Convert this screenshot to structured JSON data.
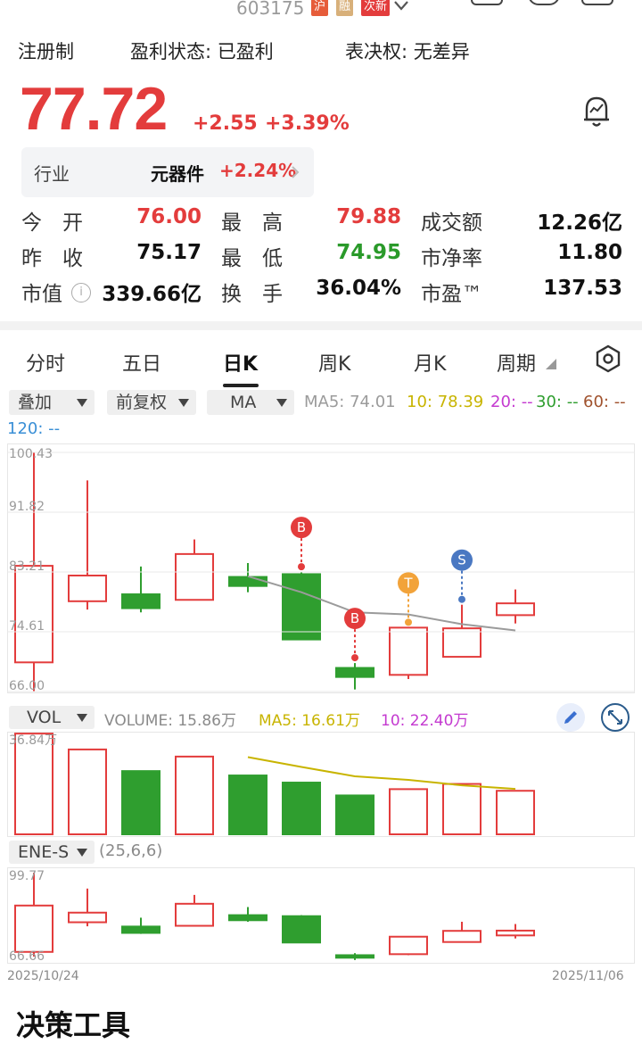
{
  "header": {
    "code": "603175",
    "tags": [
      {
        "label": "沪",
        "color": "#e65c3a"
      },
      {
        "label": "融",
        "color": "#d8b07a"
      },
      {
        "label": "次新",
        "color": "#e33c3c"
      }
    ]
  },
  "info": {
    "registration": "注册制",
    "profit_status": "盈利状态: 已盈利",
    "voting_rights": "表决权: 无差异"
  },
  "price": {
    "last": "77.72",
    "change": "+2.55",
    "change_pct": "+3.39%"
  },
  "industry": {
    "label": "行业",
    "name": "元器件",
    "change": "+2.24%"
  },
  "quote": [
    [
      {
        "label": "今　开",
        "value": "76.00",
        "cls": "red"
      },
      {
        "label": "最　高",
        "value": "79.88",
        "cls": "red"
      },
      {
        "label": "成交额",
        "value": "12.26亿",
        "cls": "dark"
      }
    ],
    [
      {
        "label": "昨　收",
        "value": "75.17",
        "cls": "dark"
      },
      {
        "label": "最　低",
        "value": "74.95",
        "cls": "green"
      },
      {
        "label": "市净率",
        "value": "11.80",
        "cls": "dark"
      }
    ],
    [
      {
        "label": "市值",
        "value": "339.66亿",
        "cls": "dark"
      },
      {
        "label": "换　手",
        "value": "36.04%",
        "cls": "dark"
      },
      {
        "label": "市盈™",
        "value": "137.53",
        "cls": "dark"
      }
    ]
  ],
  "tabs": [
    "分时",
    "五日",
    "日K",
    "周K",
    "月K",
    "周期"
  ],
  "active_tab": "日K",
  "toolbar": {
    "overlay": "叠加",
    "adjust": "前复权",
    "indicator": "MA"
  },
  "ma_legend": {
    "ma5": "MA5: 74.01",
    "ma10": "10: 78.39",
    "ma20": "20: --",
    "ma30": "30: --",
    "ma60": "60: --",
    "ma120": "120: --"
  },
  "colors": {
    "up": "#e33c3c",
    "down": "#2f9e2f",
    "ma5": "#9b9b9b",
    "ma10": "#c8b400",
    "ma20": "#c43ad0",
    "ma30": "#2f9e2f",
    "ma60": "#a0522d",
    "ma120": "#3a8fd6"
  },
  "chart_data": [
    {
      "type": "candlestick",
      "y_ticks": [
        "100.43",
        "91.82",
        "83.21",
        "74.61",
        "66.00"
      ],
      "ylim": [
        66.0,
        100.43
      ],
      "candles": [
        {
          "open": 70.2,
          "close": 84.1,
          "high": 100.43,
          "low": 66.0
        },
        {
          "open": 79.0,
          "close": 82.7,
          "high": 96.4,
          "low": 77.8
        },
        {
          "open": 80.0,
          "close": 78.0,
          "high": 84.0,
          "low": 77.4
        },
        {
          "open": 79.2,
          "close": 85.8,
          "high": 87.9,
          "low": 79.2
        },
        {
          "open": 82.5,
          "close": 81.2,
          "high": 84.5,
          "low": 80.3
        },
        {
          "open": 82.9,
          "close": 73.5,
          "high": 83.2,
          "low": 73.5
        },
        {
          "open": 69.4,
          "close": 68.1,
          "high": 70.1,
          "low": 66.3
        },
        {
          "open": 68.4,
          "close": 75.2,
          "high": 75.2,
          "low": 67.8
        },
        {
          "open": 71.0,
          "close": 75.1,
          "high": 78.5,
          "low": 71.0
        },
        {
          "open": 77.0,
          "close": 78.7,
          "high": 80.7,
          "low": 75.8
        }
      ],
      "ma5": [
        null,
        null,
        null,
        null,
        82.6,
        80.3,
        77.4,
        77.1,
        75.7,
        74.8
      ],
      "signals": [
        {
          "index": 5,
          "label": "B",
          "color": "#e33c3c"
        },
        {
          "index": 6,
          "label": "B",
          "color": "#e33c3c"
        },
        {
          "index": 7,
          "label": "T",
          "color": "#f2a33a"
        },
        {
          "index": 8,
          "label": "S",
          "color": "#4a78c2"
        }
      ]
    },
    {
      "type": "bar",
      "label": "VOL",
      "legend": {
        "volume": "VOLUME: 15.86万",
        "ma5": "MA5: 16.61万",
        "ma10": "10: 22.40万"
      },
      "y_top_tick": "36.84万",
      "values": [
        36.8,
        31.0,
        23.1,
        28.4,
        21.5,
        18.9,
        14.2,
        16.5,
        18.4,
        15.9
      ],
      "up": [
        true,
        true,
        false,
        true,
        false,
        false,
        false,
        true,
        true,
        true
      ],
      "ma5": [
        null,
        null,
        null,
        null,
        28.2,
        24.6,
        21.2,
        19.9,
        17.9,
        16.6
      ]
    },
    {
      "type": "candlestick",
      "label": "ENE-S",
      "params": "(25,6,6)",
      "y_ticks": [
        "99.77",
        "66.66"
      ],
      "ylim": [
        66.66,
        99.77
      ],
      "candles": [
        {
          "open": 68.5,
          "close": 86.8,
          "high": 99.77,
          "low": 66.66
        },
        {
          "open": 80.2,
          "close": 84.0,
          "high": 93.5,
          "low": 78.6
        },
        {
          "open": 78.5,
          "close": 76.0,
          "high": 82.0,
          "low": 75.6
        },
        {
          "open": 78.8,
          "close": 87.5,
          "high": 91.0,
          "low": 78.8
        },
        {
          "open": 83.0,
          "close": 81.0,
          "high": 86.2,
          "low": 80.4
        },
        {
          "open": 82.6,
          "close": 72.2,
          "high": 83.0,
          "low": 72.2
        },
        {
          "open": 67.2,
          "close": 66.2,
          "high": 68.0,
          "low": 65.3
        },
        {
          "open": 67.6,
          "close": 74.5,
          "high": 74.5,
          "low": 67.2
        },
        {
          "open": 72.4,
          "close": 76.8,
          "high": 80.4,
          "low": 72.4
        },
        {
          "open": 75.0,
          "close": 76.9,
          "high": 79.5,
          "low": 73.8
        }
      ]
    }
  ],
  "dates": {
    "start": "2025/10/24",
    "end": "2025/11/06"
  },
  "footer_partial": "决策工具"
}
